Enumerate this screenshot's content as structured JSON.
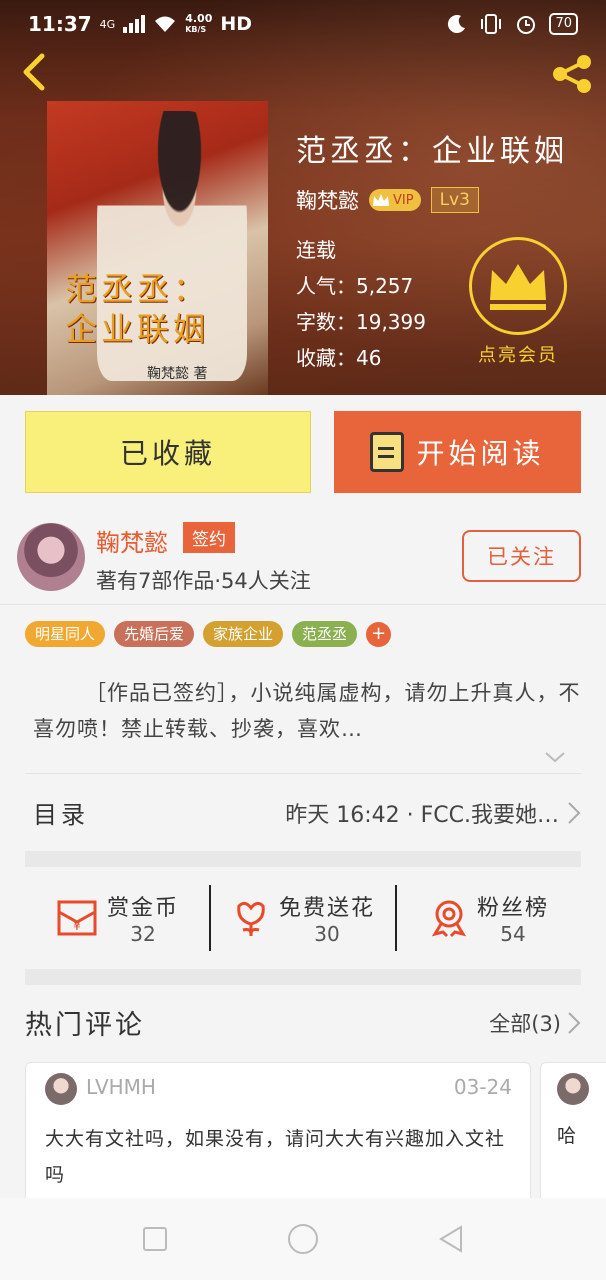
{
  "status_bar": {
    "time": "11:37",
    "network": "4G",
    "speed_value": "4.00",
    "speed_unit": "KB/S",
    "hd": "HD",
    "battery": "70"
  },
  "book": {
    "title": "范丞丞：企业联姻",
    "cover_title_line1": "范丞丞：",
    "cover_title_line2": "企业联姻",
    "cover_author": "鞠梵懿 著",
    "author": "鞠梵懿",
    "vip_label": "VIP",
    "level": "Lv3",
    "status": "连载",
    "popularity": "人气：5,257",
    "word_count": "字数：19,399",
    "favorites": "收藏：46",
    "member_label": "点亮会员"
  },
  "actions": {
    "favorite_label": "已收藏",
    "read_label": "开始阅读"
  },
  "author_section": {
    "name": "鞠梵懿",
    "signed_badge": "签约",
    "info": "著有7部作品·54人关注",
    "follow_label": "已关注"
  },
  "tags": [
    {
      "label": "明星同人",
      "color": "#f0a830"
    },
    {
      "label": "先婚后爱",
      "color": "#c8705a"
    },
    {
      "label": "家族企业",
      "color": "#d4a030"
    },
    {
      "label": "范丞丞",
      "color": "#8ab050"
    }
  ],
  "tag_add": "+",
  "description": "［作品已签约］，小说纯属虚构，请勿上升真人，不喜勿喷！禁止转载、抄袭，喜欢…",
  "toc": {
    "label": "目录",
    "latest": "昨天 16:42 · FCC.我要她…"
  },
  "rewards": [
    {
      "label": "赏金币",
      "value": "32",
      "icon": "coin-envelope-icon"
    },
    {
      "label": "免费送花",
      "value": "30",
      "icon": "flower-icon"
    },
    {
      "label": "粉丝榜",
      "value": "54",
      "icon": "medal-icon"
    }
  ],
  "hot_comments": {
    "heading": "热门评论",
    "all_label": "全部(3)",
    "items": [
      {
        "user": "LVHMH",
        "date": "03-24",
        "text": "大大有文社吗，如果没有，请问大大有兴趣加入文社吗"
      },
      {
        "user": "",
        "date": "",
        "text": "哈"
      }
    ]
  },
  "colors": {
    "accent": "#e8653c",
    "gold": "#f8d030",
    "favorite_bg": "#f8f07a"
  }
}
